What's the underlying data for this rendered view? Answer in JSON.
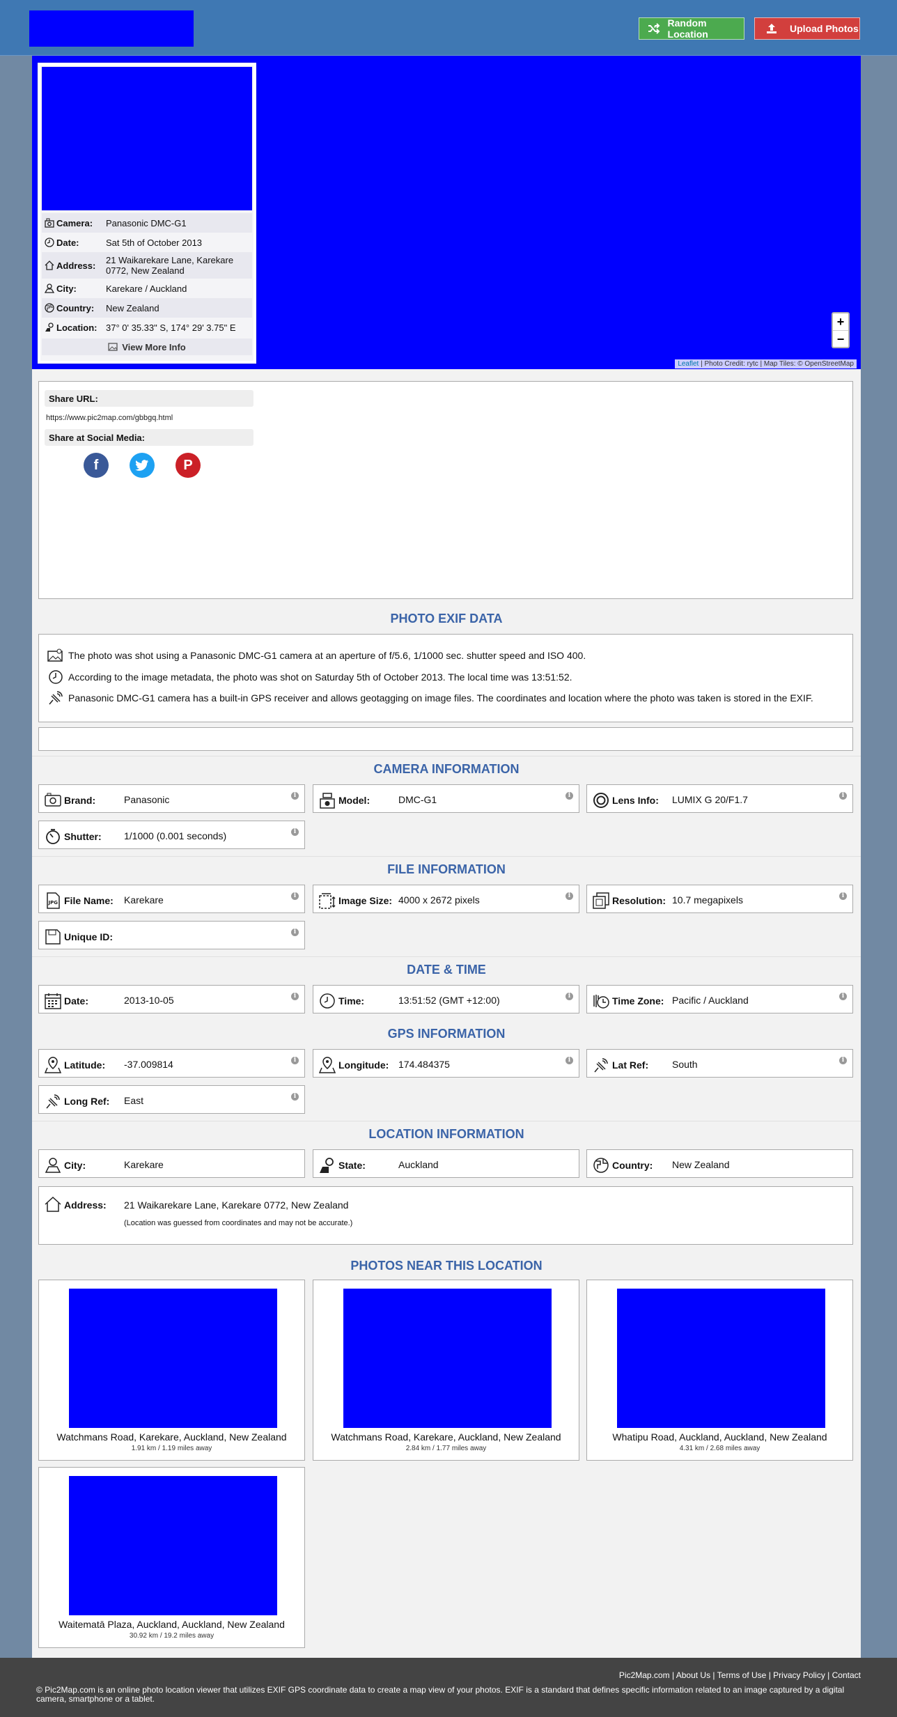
{
  "header": {
    "random_label": "Random Location",
    "upload_label": "Upload Photos"
  },
  "map": {
    "zoom_in": "+",
    "zoom_out": "−",
    "attribution_leaflet": "Leaflet",
    "attribution_rest": " | Photo Credit: rytc | Map Tiles: © OpenStreetMap"
  },
  "info_card": {
    "rows": [
      {
        "label": "Camera:",
        "value": "Panasonic DMC-G1",
        "icon": "camera-icon"
      },
      {
        "label": "Date:",
        "value": "Sat 5th of October 2013",
        "icon": "clock-icon"
      },
      {
        "label": "Address:",
        "value": "21 Waikarekare Lane, Karekare 0772, New Zealand",
        "icon": "home-icon"
      },
      {
        "label": "City:",
        "value": "Karekare / Auckland",
        "icon": "person-pin-icon"
      },
      {
        "label": "Country:",
        "value": "New Zealand",
        "icon": "globe-icon"
      },
      {
        "label": "Location:",
        "value": "37° 0' 35.33\" S, 174° 29' 3.75\" E",
        "icon": "location-icon"
      }
    ],
    "view_more": "View More Info"
  },
  "share": {
    "url_label": "Share URL:",
    "url": "https://www.pic2map.com/gbbgq.html",
    "social_label": "Share at Social Media:",
    "facebook": "f",
    "pinterest": "P"
  },
  "exif": {
    "title": "PHOTO EXIF DATA",
    "lines": [
      "The photo was shot using a Panasonic DMC-G1 camera at an aperture of f/5.6, 1/1000 sec. shutter speed and ISO 400.",
      "According to the image metadata, the photo was shot on Saturday 5th of October 2013. The local time was 13:51:52.",
      "Panasonic DMC-G1 camera has a built-in GPS receiver and allows geotagging on image files. The coordinates and location where the photo was taken is stored in the EXIF."
    ]
  },
  "camera": {
    "title": "CAMERA INFORMATION",
    "brand_label": "Brand:",
    "brand": "Panasonic",
    "model_label": "Model:",
    "model": "DMC-G1",
    "lens_label": "Lens Info:",
    "lens": "LUMIX G 20/F1.7",
    "shutter_label": "Shutter:",
    "shutter": "1/1000 (0.001 seconds)"
  },
  "file": {
    "title": "FILE INFORMATION",
    "name_label": "File Name:",
    "name": "Karekare",
    "size_label": "Image Size:",
    "size": "4000 x 2672 pixels",
    "res_label": "Resolution:",
    "res": "10.7 megapixels",
    "uid_label": "Unique ID:",
    "uid": ""
  },
  "datetime": {
    "title": "DATE & TIME",
    "date_label": "Date:",
    "date": "2013-10-05",
    "time_label": "Time:",
    "time": "13:51:52 (GMT +12:00)",
    "tz_label": "Time Zone:",
    "tz": "Pacific / Auckland"
  },
  "gps": {
    "title": "GPS INFORMATION",
    "lat_label": "Latitude:",
    "lat": "-37.009814",
    "lon_label": "Longitude:",
    "lon": "174.484375",
    "latref_label": "Lat Ref:",
    "latref": "South",
    "lonref_label": "Long Ref:",
    "lonref": "East"
  },
  "location": {
    "title": "LOCATION INFORMATION",
    "city_label": "City:",
    "city": "Karekare",
    "state_label": "State:",
    "state": "Auckland",
    "country_label": "Country:",
    "country": "New Zealand",
    "address_label": "Address:",
    "address": "21 Waikarekare Lane, Karekare 0772, New Zealand",
    "address_note": "(Location was guessed from coordinates and may not be accurate.)"
  },
  "nearby": {
    "title": "PHOTOS NEAR THIS LOCATION",
    "photos": [
      {
        "name": "Watchmans Road, Karekare, Auckland, New Zealand",
        "distance": "1.91 km / 1.19 miles away"
      },
      {
        "name": "Watchmans Road, Karekare, Auckland, New Zealand",
        "distance": "2.84 km / 1.77 miles away"
      },
      {
        "name": "Whatipu Road, Auckland, Auckland, New Zealand",
        "distance": "4.31 km / 2.68 miles away"
      },
      {
        "name": "Waitematā Plaza, Auckland, Auckland, New Zealand",
        "distance": "30.92 km / 19.2 miles away"
      }
    ]
  },
  "footer": {
    "links": [
      "Pic2Map.com",
      "About Us",
      "Terms of Use",
      "Privacy Policy",
      "Contact"
    ],
    "copyright": "© Pic2Map.com is an online photo location viewer that utilizes EXIF GPS coordinate data to create a map view of your photos. EXIF is a standard that defines specific information related to an image captured by a digital camera, smartphone or a tablet."
  }
}
